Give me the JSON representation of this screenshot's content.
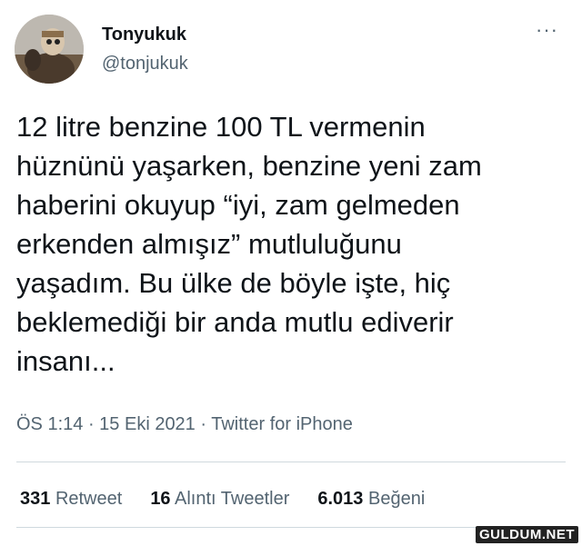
{
  "author": {
    "name": "Tonyukuk",
    "handle": "@tonjukuk"
  },
  "menu_icon": "more-horizontal-icon",
  "tweet": {
    "text": "12 litre benzine 100 TL vermenin\nhüznünü yaşarken, benzine yeni zam\nhaberini okuyup “iyi, zam gelmeden\nerkenden almışız” mutluluğunu\nyaşadım. Bu ülke de böyle işte, hiç\nbeklemediği bir anda mutlu ediverir\ninsanı...",
    "time": "ÖS 1:14",
    "date": "15 Eki 2021",
    "source": "Twitter for iPhone"
  },
  "stats": {
    "retweets": {
      "count": "331",
      "label": "Retweet"
    },
    "quotes": {
      "count": "16",
      "label": "Alıntı Tweetler"
    },
    "likes": {
      "count": "6.013",
      "label": "Beğeni"
    }
  },
  "watermark": "GULDUM.NET"
}
